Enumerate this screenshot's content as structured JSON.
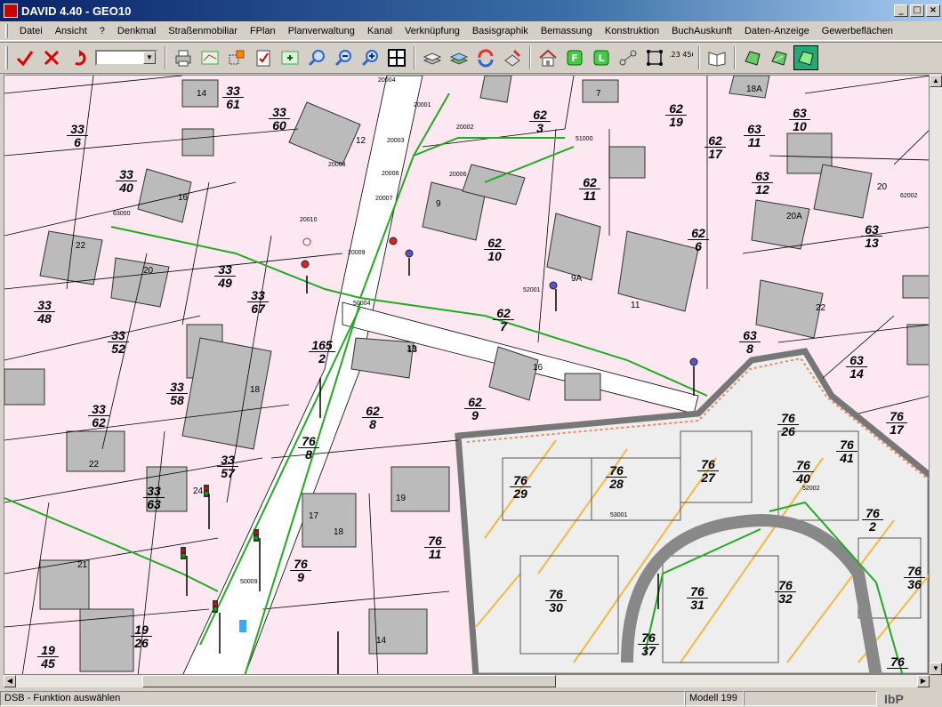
{
  "window": {
    "title": "DAVID 4.40 - GEO10",
    "min_glyph": "_",
    "max_glyph": "□",
    "close_glyph": "×"
  },
  "menu": [
    "Datei",
    "Ansicht",
    "?",
    "Denkmal",
    "Straßenmobiliar",
    "FPlan",
    "Planverwaltung",
    "Kanal",
    "Verknüpfung",
    "Basisgraphik",
    "Bemassung",
    "Konstruktion",
    "BuchAuskunft",
    "Daten-Anzeige",
    "Gewerbeflächen"
  ],
  "toolbar": {
    "icons": [
      "check-icon",
      "cancel-icon",
      "undo-icon",
      "print-icon",
      "map-icon",
      "select-icon",
      "edit-icon",
      "zoom-window-icon",
      "zoom-icon",
      "zoom-out-icon",
      "zoom-in-icon",
      "grid-icon",
      "layers-icon",
      "layers2-icon",
      "refresh-icon",
      "paint-icon",
      "home-icon",
      "f-icon",
      "l-icon",
      "node-icon",
      "square-icon",
      "coords-icon",
      "book-icon",
      "map1-icon",
      "map2-icon",
      "map3-icon"
    ],
    "combo_value": "",
    "f_label": "F",
    "l_label": "L",
    "coords_label": "123 456"
  },
  "parcels": [
    {
      "a": "33",
      "b": "61"
    },
    {
      "a": "33",
      "b": "60"
    },
    {
      "a": "33",
      "b": "6"
    },
    {
      "a": "33",
      "b": "40"
    },
    {
      "a": "33",
      "b": "49"
    },
    {
      "a": "33",
      "b": "67"
    },
    {
      "a": "33",
      "b": "48"
    },
    {
      "a": "33",
      "b": "52"
    },
    {
      "a": "33",
      "b": "58"
    },
    {
      "a": "33",
      "b": "62"
    },
    {
      "a": "33",
      "b": "57"
    },
    {
      "a": "33",
      "b": "63"
    },
    {
      "a": "19",
      "b": "26"
    },
    {
      "a": "19",
      "b": "45"
    },
    {
      "a": "165",
      "b": "2"
    },
    {
      "a": "62",
      "b": "8"
    },
    {
      "a": "62",
      "b": "9"
    },
    {
      "a": "62",
      "b": "7"
    },
    {
      "a": "62",
      "b": "10"
    },
    {
      "a": "62",
      "b": "11"
    },
    {
      "a": "62",
      "b": "3"
    },
    {
      "a": "62",
      "b": "19"
    },
    {
      "a": "62",
      "b": "17"
    },
    {
      "a": "62",
      "b": "6"
    },
    {
      "a": "63",
      "b": "11"
    },
    {
      "a": "63",
      "b": "10"
    },
    {
      "a": "63",
      "b": "12"
    },
    {
      "a": "63",
      "b": "13"
    },
    {
      "a": "63",
      "b": "8"
    },
    {
      "a": "63",
      "b": "14"
    },
    {
      "a": "76",
      "b": "8"
    },
    {
      "a": "76",
      "b": "11"
    },
    {
      "a": "76",
      "b": "9"
    },
    {
      "a": "76",
      "b": "29"
    },
    {
      "a": "76",
      "b": "28"
    },
    {
      "a": "76",
      "b": "27"
    },
    {
      "a": "76",
      "b": "26"
    },
    {
      "a": "76",
      "b": "17"
    },
    {
      "a": "76",
      "b": "41"
    },
    {
      "a": "76",
      "b": "40"
    },
    {
      "a": "76",
      "b": "2"
    },
    {
      "a": "76",
      "b": "36"
    },
    {
      "a": "76",
      "b": "30"
    },
    {
      "a": "76",
      "b": "31"
    },
    {
      "a": "76",
      "b": "32"
    },
    {
      "a": "76",
      "b": "37"
    },
    {
      "a": "76",
      "b": ""
    }
  ],
  "house_numbers": [
    "14",
    "12",
    "16",
    "22",
    "20",
    "18",
    "22",
    "24",
    "21",
    "19",
    "17",
    "18",
    "13",
    "16",
    "9",
    "9A",
    "11",
    "7",
    "18A",
    "20",
    "20A",
    "22",
    "14",
    "13"
  ],
  "annotations": [
    "20004",
    "20001",
    "20002",
    "20003",
    "20008",
    "20006",
    "20007",
    "20010",
    "20009",
    "50004",
    "52001",
    "62002",
    "63000",
    "52002",
    "53001",
    "50009",
    "51000",
    "20006"
  ],
  "status": {
    "message": "DSB - Funktion auswählen",
    "modell": "Modell 199",
    "logo": "IbP"
  }
}
